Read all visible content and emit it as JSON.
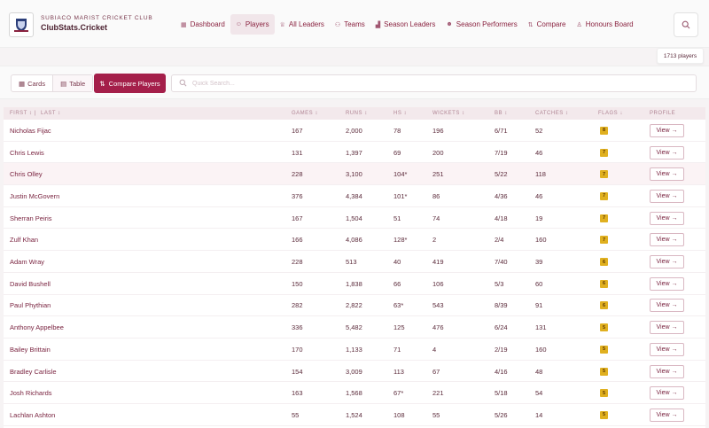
{
  "header": {
    "club_name": "SUBIACO MARIST CRICKET CLUB",
    "brand": "ClubStats.Cricket"
  },
  "nav": [
    {
      "label": "Dashboard",
      "icon": "grid-icon",
      "glyph": "▦"
    },
    {
      "label": "Players",
      "icon": "users-icon",
      "glyph": "☺"
    },
    {
      "label": "All Leaders",
      "icon": "trophy-icon",
      "glyph": "♕"
    },
    {
      "label": "Teams",
      "icon": "team-icon",
      "glyph": "⚇"
    },
    {
      "label": "Season Leaders",
      "icon": "chart-icon",
      "glyph": "▟"
    },
    {
      "label": "Season Performers",
      "icon": "people-icon",
      "glyph": "☻"
    },
    {
      "label": "Compare",
      "icon": "compare-icon",
      "glyph": "⇅"
    },
    {
      "label": "Honours Board",
      "icon": "award-icon",
      "glyph": "♙"
    }
  ],
  "player_count": "1713 players",
  "toolbar": {
    "cards_label": "Cards",
    "table_label": "Table",
    "compare_label": "Compare Players",
    "search_placeholder": "Quick Search..."
  },
  "columns": {
    "first": "FIRST",
    "sep": "|",
    "last": "LAST",
    "games": "GAMES",
    "runs": "RUNS",
    "hs": "HS",
    "wickets": "WICKETS",
    "bb": "BB",
    "catches": "CATCHES",
    "flags": "FLAGS",
    "profile": "PROFILE"
  },
  "sort_glyph": "↕",
  "sort_active_glyph": "↓",
  "view_label": "View →",
  "rows": [
    {
      "name": "Nicholas Fijac",
      "games": "167",
      "runs": "2,000",
      "hs": "78",
      "wickets": "196",
      "bb": "6/71",
      "catches": "52",
      "flags": "8"
    },
    {
      "name": "Chris Lewis",
      "games": "131",
      "runs": "1,397",
      "hs": "69",
      "wickets": "200",
      "bb": "7/19",
      "catches": "46",
      "flags": "7"
    },
    {
      "name": "Chris Olley",
      "games": "228",
      "runs": "3,100",
      "hs": "104*",
      "wickets": "251",
      "bb": "5/22",
      "catches": "118",
      "flags": "7"
    },
    {
      "name": "Justin McGovern",
      "games": "376",
      "runs": "4,384",
      "hs": "101*",
      "wickets": "86",
      "bb": "4/36",
      "catches": "46",
      "flags": "7"
    },
    {
      "name": "Sherran Peiris",
      "games": "167",
      "runs": "1,504",
      "hs": "51",
      "wickets": "74",
      "bb": "4/18",
      "catches": "19",
      "flags": "7"
    },
    {
      "name": "Zulf Khan",
      "games": "166",
      "runs": "4,086",
      "hs": "128*",
      "wickets": "2",
      "bb": "2/4",
      "catches": "160",
      "flags": "7"
    },
    {
      "name": "Adam Wray",
      "games": "228",
      "runs": "513",
      "hs": "40",
      "wickets": "419",
      "bb": "7/40",
      "catches": "39",
      "flags": "6"
    },
    {
      "name": "David Bushell",
      "games": "150",
      "runs": "1,838",
      "hs": "66",
      "wickets": "106",
      "bb": "5/3",
      "catches": "60",
      "flags": "6"
    },
    {
      "name": "Paul Phythian",
      "games": "282",
      "runs": "2,822",
      "hs": "63*",
      "wickets": "543",
      "bb": "8/39",
      "catches": "91",
      "flags": "6"
    },
    {
      "name": "Anthony Appelbee",
      "games": "336",
      "runs": "5,482",
      "hs": "125",
      "wickets": "476",
      "bb": "6/24",
      "catches": "131",
      "flags": "5"
    },
    {
      "name": "Bailey Brittain",
      "games": "170",
      "runs": "1,133",
      "hs": "71",
      "wickets": "4",
      "bb": "2/19",
      "catches": "160",
      "flags": "5"
    },
    {
      "name": "Bradley Carlisle",
      "games": "154",
      "runs": "3,009",
      "hs": "113",
      "wickets": "67",
      "bb": "4/16",
      "catches": "48",
      "flags": "5"
    },
    {
      "name": "Josh Richards",
      "games": "163",
      "runs": "1,568",
      "hs": "67*",
      "wickets": "221",
      "bb": "5/18",
      "catches": "54",
      "flags": "5"
    },
    {
      "name": "Lachlan Ashton",
      "games": "55",
      "runs": "1,524",
      "hs": "108",
      "wickets": "55",
      "bb": "5/26",
      "catches": "14",
      "flags": "5"
    }
  ],
  "colors": {
    "accent": "#a41f4a",
    "flag": "#e0b020",
    "highlight_row": "#fbf3f5"
  }
}
